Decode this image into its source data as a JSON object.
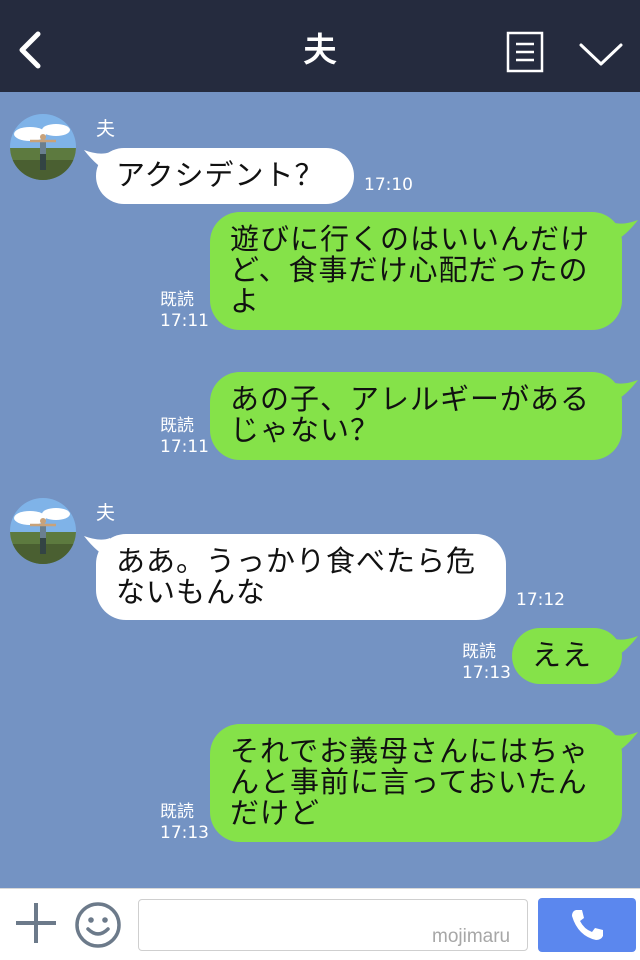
{
  "header": {
    "title": "夫",
    "back_icon": "chevron-left-icon",
    "menu_icon": "list-icon",
    "collapse_icon": "chevron-down-icon",
    "background_color": "#252b3e"
  },
  "messages": [
    {
      "direction": "incoming",
      "sender": "夫",
      "lines": [
        "アクシデント？"
      ],
      "time": "17:10"
    },
    {
      "direction": "outgoing",
      "lines": [
        "遊びに行くのはいいんだけ",
        "ど、食事だけ心配だったの",
        "よ"
      ],
      "read": "既読",
      "time": "17:11"
    },
    {
      "direction": "outgoing",
      "lines": [
        "あの子、アレルギーがある",
        "じゃない？"
      ],
      "read": "既読",
      "time": "17:11"
    },
    {
      "direction": "incoming",
      "sender": "夫",
      "lines": [
        "ああ。うっかり食べたら危",
        "ないもんな"
      ],
      "time": "17:12"
    },
    {
      "direction": "outgoing",
      "lines": [
        "ええ"
      ],
      "read": "既読",
      "time": "17:13"
    },
    {
      "direction": "outgoing",
      "lines": [
        "それでお義母さんにはちゃ",
        "んと事前に言っておいたん",
        "だけど"
      ],
      "read": "既読",
      "time": "17:13"
    }
  ],
  "footer": {
    "plus_icon": "plus-icon",
    "emoji_icon": "smiley-icon",
    "input_value": "",
    "watermark": "mojimaru",
    "call_icon": "phone-icon"
  },
  "colors": {
    "chat_background": "#7493c3",
    "incoming_bubble": "#ffffff",
    "outgoing_bubble": "#85e249",
    "call_button": "#5b87ee"
  }
}
